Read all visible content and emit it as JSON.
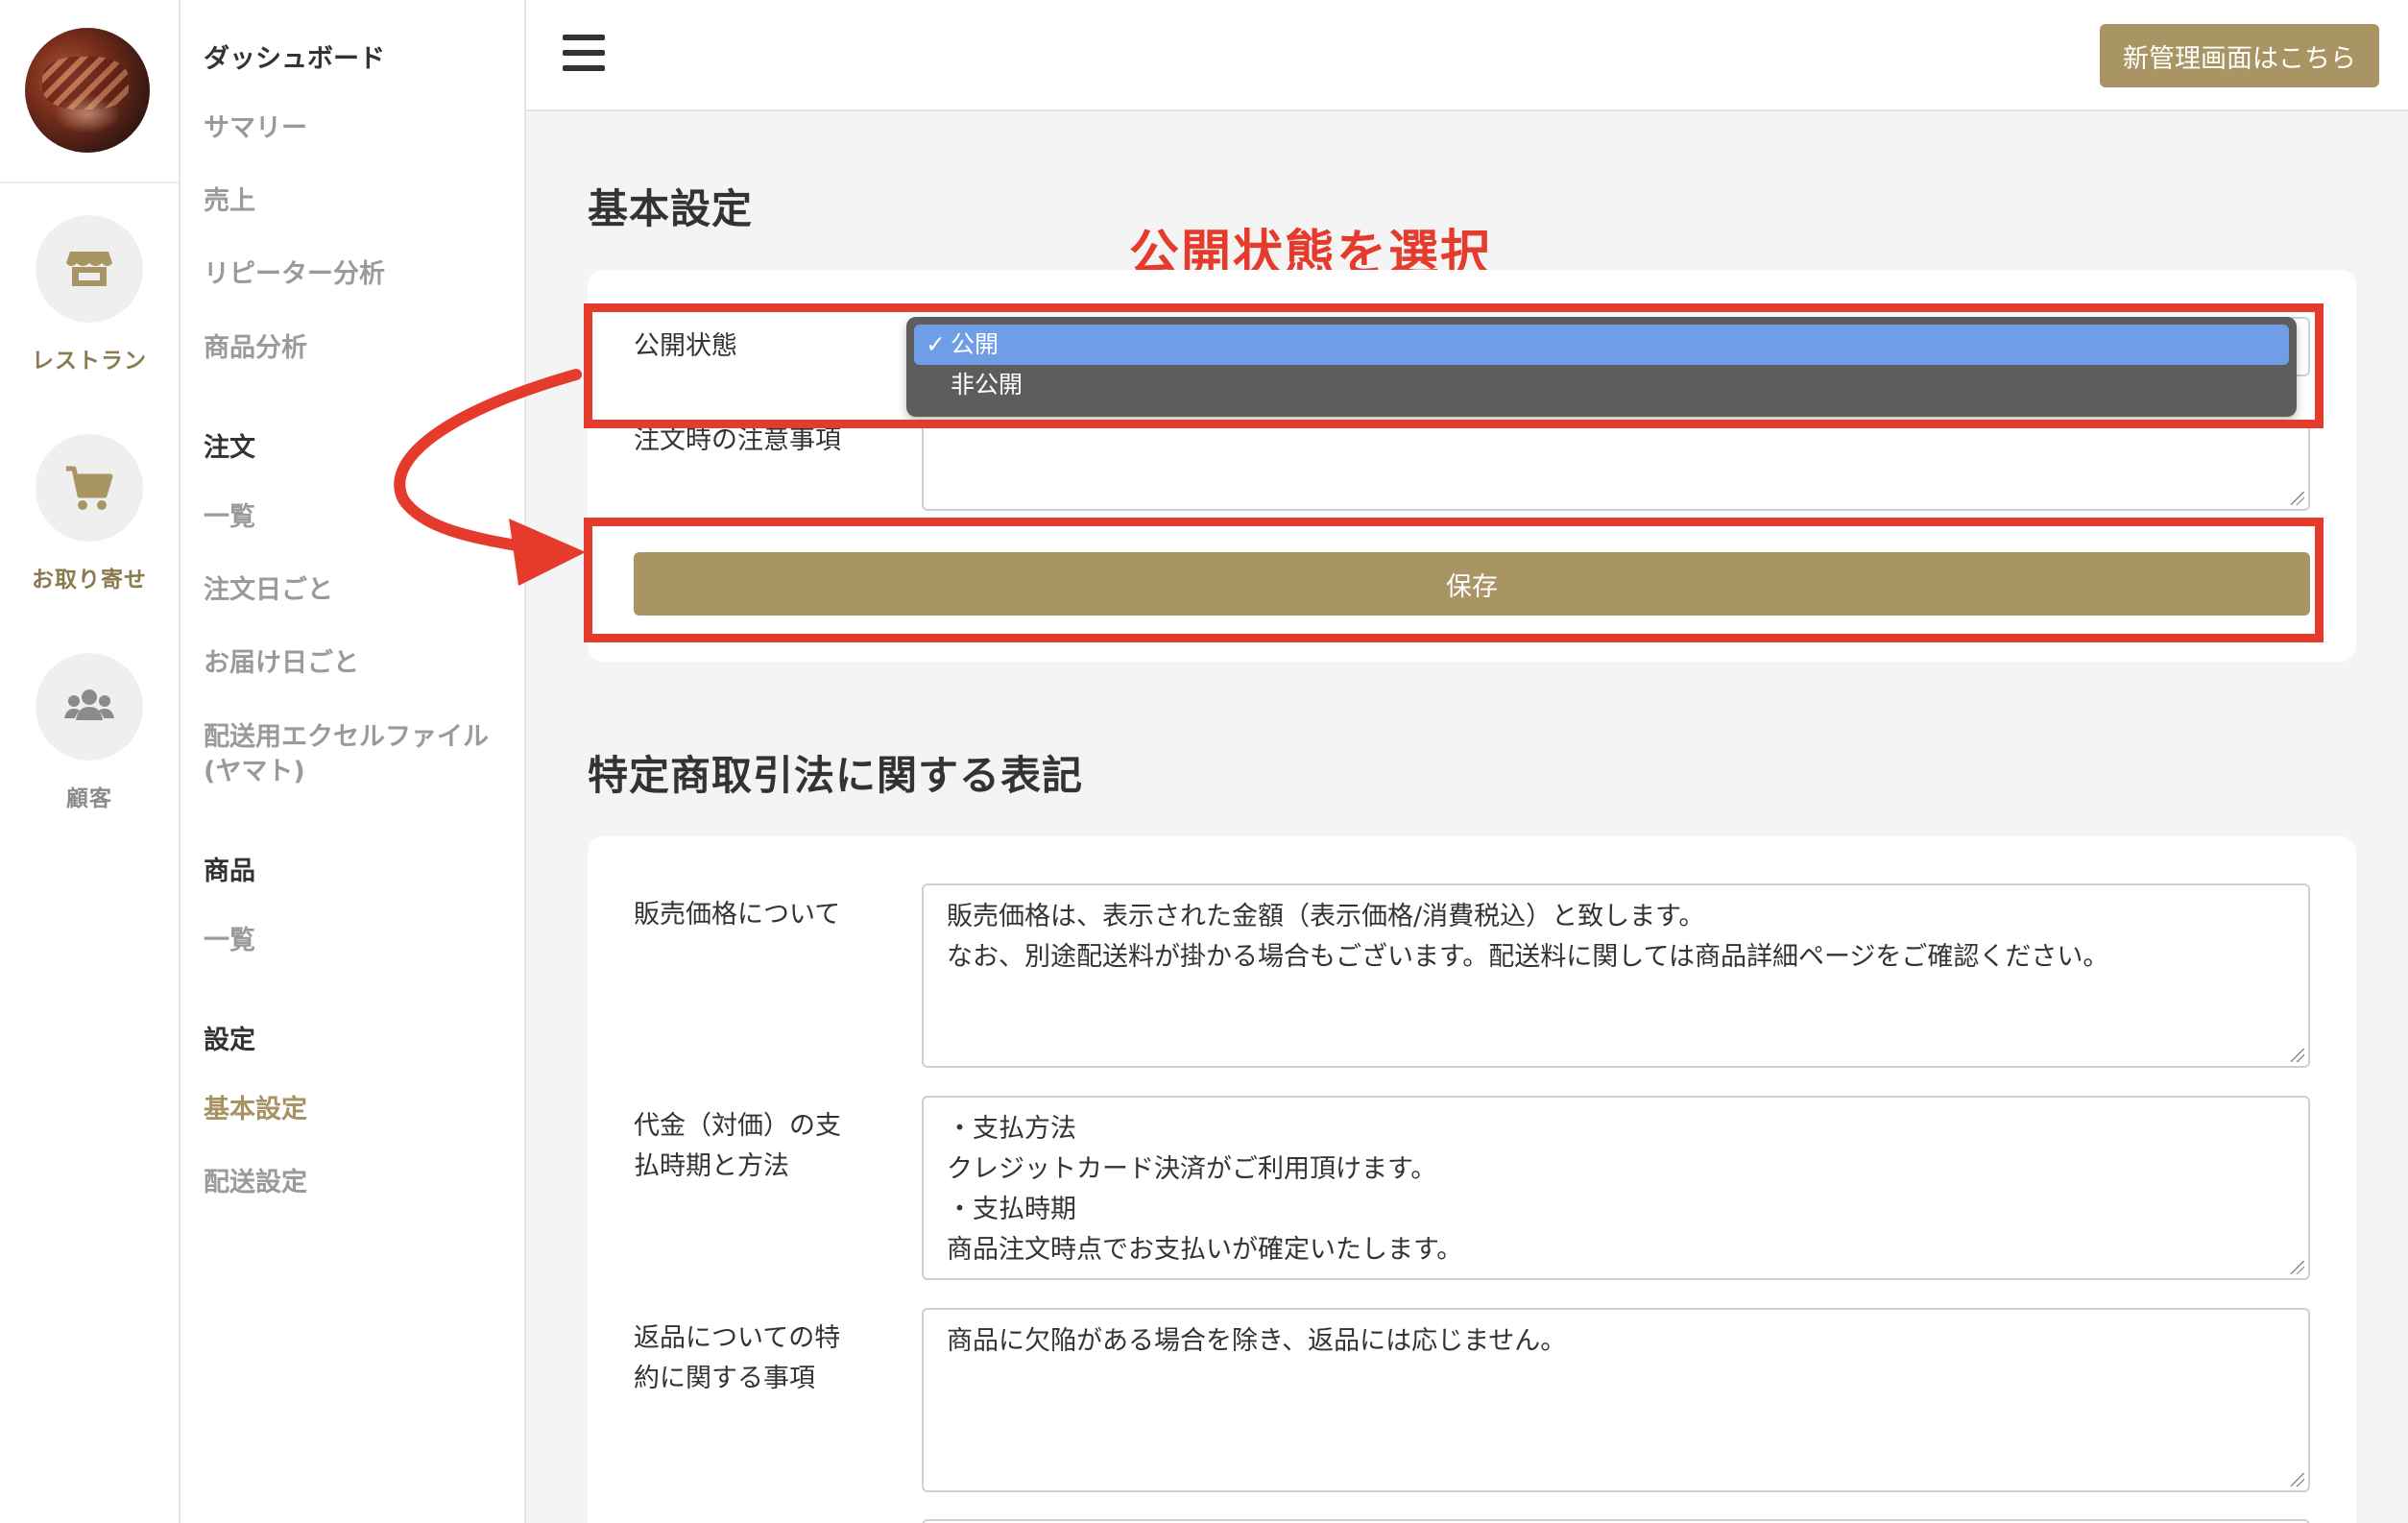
{
  "rail": {
    "items": [
      {
        "label": "レストラン",
        "icon": "store-icon"
      },
      {
        "label": "お取り寄せ",
        "icon": "cart-icon"
      },
      {
        "label": "顧客",
        "icon": "users-icon"
      }
    ]
  },
  "sidebar": {
    "dashboard": "ダッシュボード",
    "summary": "サマリー",
    "sales": "売上",
    "repeater": "リピーター分析",
    "product_analysis": "商品分析",
    "orders_head": "注文",
    "orders_list": "一覧",
    "orders_by_date": "注文日ごと",
    "orders_by_delivery": "お届け日ごと",
    "shipping_excel": "配送用エクセルファイル",
    "shipping_excel_2": "(ヤマト)",
    "products_head": "商品",
    "products_list": "一覧",
    "settings_head": "設定",
    "basic_settings": "基本設定",
    "shipping_settings": "配送設定"
  },
  "topbar": {
    "new_admin_button": "新管理画面はこちら"
  },
  "basic": {
    "title": "基本設定",
    "annotation": "公開状態を選択",
    "status_label": "公開状態",
    "status_options": [
      "公開",
      "非公開"
    ],
    "status_selected": "公開",
    "notes_label": "注文時の注意事項",
    "save_button": "保存"
  },
  "legal": {
    "title": "特定商取引法に関する表記",
    "price_label": "販売価格について",
    "price_value": "販売価格は、表示された金額（表示価格/消費税込）と致します。\nなお、別途配送料が掛かる場合もございます。配送料に関しては商品詳細ページをご確認ください。",
    "payment_label_1": "代金（対価）の支",
    "payment_label_2": "払時期と方法",
    "payment_value": "・支払方法\nクレジットカード決済がご利用頂けます。\n・支払時期\n商品注文時点でお支払いが確定いたします。",
    "returns_label_1": "返品についての特",
    "returns_label_2": "約に関する事項",
    "returns_value": "商品に欠陥がある場合を除き、返品には応じません。"
  },
  "colors": {
    "accent": "#a99463",
    "annotation": "#e53b2c",
    "selected_option": "#6f9de6"
  }
}
